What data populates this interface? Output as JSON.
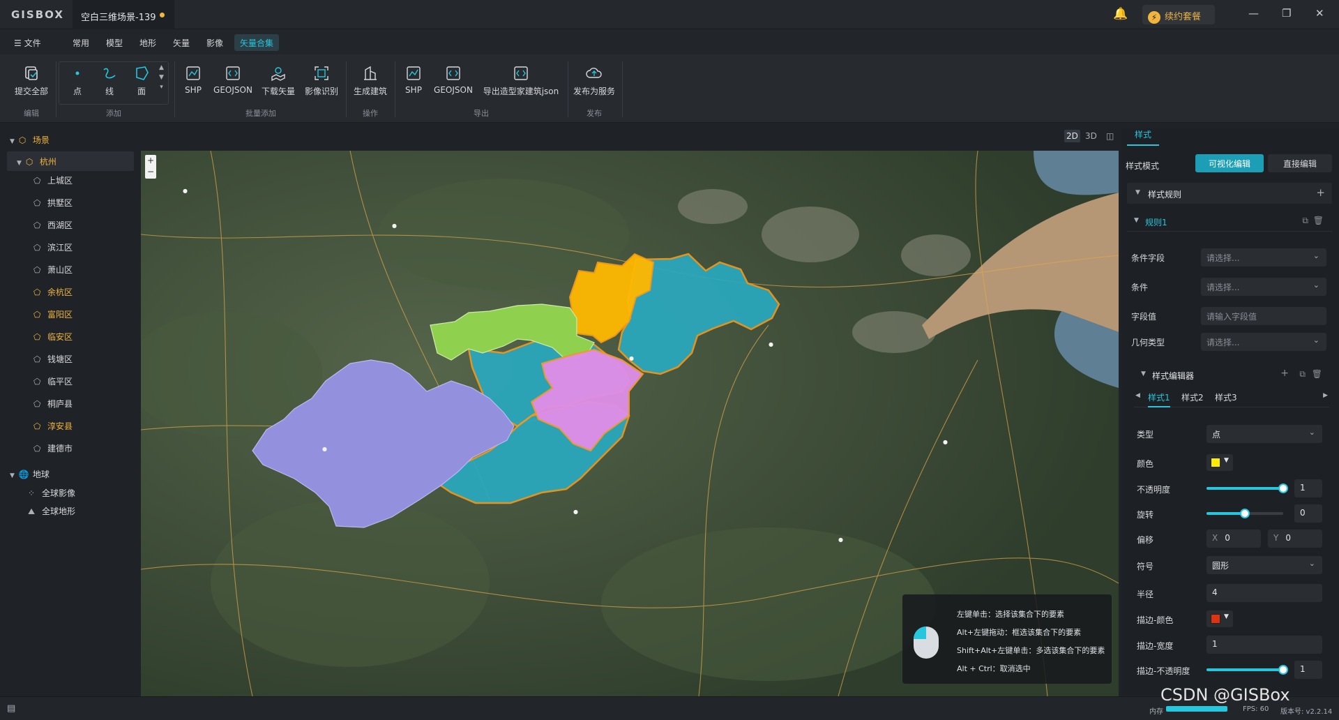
{
  "app": {
    "logo": "GISBOX",
    "tab_title": "空白三维场景-139",
    "renew_label": "续约套餐"
  },
  "menu": {
    "file": "文件",
    "items": [
      "常用",
      "模型",
      "地形",
      "矢量",
      "影像"
    ],
    "active": "矢量合集"
  },
  "ribbon": {
    "submit_all": "提交全部",
    "group_edit": "编辑",
    "point": "点",
    "line": "线",
    "polygon": "面",
    "group_add": "添加",
    "shp": "SHP",
    "geojson": "GEOJSON",
    "download_vector": "下载矢量",
    "image_recognize": "影像识别",
    "group_batch_add": "批量添加",
    "generate_building": "生成建筑",
    "group_operation": "操作",
    "export_shp": "SHP",
    "export_geojson": "GEOJSON",
    "export_building_json": "导出造型家建筑json",
    "group_export": "导出",
    "publish_service": "发布为服务",
    "group_publish": "发布"
  },
  "tree": {
    "scene": "场景",
    "hangzhou": "杭州",
    "districts": [
      {
        "label": "上城区",
        "highlight": false
      },
      {
        "label": "拱墅区",
        "highlight": false
      },
      {
        "label": "西湖区",
        "highlight": false
      },
      {
        "label": "滨江区",
        "highlight": false
      },
      {
        "label": "萧山区",
        "highlight": false
      },
      {
        "label": "余杭区",
        "highlight": true
      },
      {
        "label": "富阳区",
        "highlight": true
      },
      {
        "label": "临安区",
        "highlight": true
      },
      {
        "label": "钱塘区",
        "highlight": false
      },
      {
        "label": "临平区",
        "highlight": false
      },
      {
        "label": "桐庐县",
        "highlight": false
      },
      {
        "label": "淳安县",
        "highlight": true
      },
      {
        "label": "建德市",
        "highlight": false
      }
    ],
    "earth": "地球",
    "global_imagery": "全球影像",
    "global_terrain": "全球地形"
  },
  "view_modes": [
    "2D",
    "3D"
  ],
  "map": {
    "zoom_in": "+",
    "zoom_out": "−",
    "hints": [
      "左键单击：选择该集合下的要素",
      "Alt+左键拖动：框选该集合下的要素",
      "Shift+Alt+左键单击：多选该集合下的要素",
      "Alt + Ctrl：取消选中"
    ],
    "colors": {
      "teal": "#2aa9bf",
      "green": "#8fd14f",
      "yellow": "#ffb800",
      "violet": "#dd8ee6",
      "lavender": "#9390dd",
      "outline": "#f29a1c"
    }
  },
  "panel": {
    "tab": "样式",
    "style_mode": "样式模式",
    "visual_edit": "可视化编辑",
    "direct_edit": "直接编辑",
    "style_rules": "样式规则",
    "rule1": "规则1",
    "condition_field": "条件字段",
    "condition": "条件",
    "field_value": "字段值",
    "geometry_type": "几何类型",
    "select_placeholder": "请选择...",
    "value_placeholder": "请输入字段值",
    "style_editor": "样式编辑器",
    "style_tabs": [
      "样式1",
      "样式2",
      "样式3"
    ],
    "type_label": "类型",
    "type_value": "点",
    "color_label": "颜色",
    "color": "#ffee00",
    "opacity_label": "不透明度",
    "opacity": "1",
    "opacity_frac": 1.0,
    "rotation_label": "旋转",
    "rotation": "0",
    "rotation_frac": 0.5,
    "offset_label": "偏移",
    "offset_x_label": "X",
    "offset_x": "0",
    "offset_y_label": "Y",
    "offset_y": "0",
    "symbol_label": "符号",
    "symbol_value": "圆形",
    "radius_label": "半径",
    "radius": "4",
    "stroke_color_label": "描边-颜色",
    "stroke_color": "#dd3311",
    "stroke_width_label": "描边-宽度",
    "stroke_width": "1",
    "stroke_opacity_label": "描边-不透明度",
    "stroke_opacity": "1",
    "stroke_opacity_frac": 1.0
  },
  "status": {
    "memory": "内存",
    "fps": "FPS: 60",
    "version": "版本号: v2.2.14"
  },
  "watermark": "CSDN @GISBox"
}
